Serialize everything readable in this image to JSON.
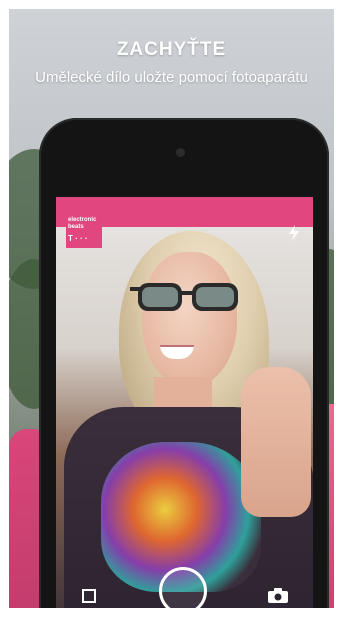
{
  "header": {
    "title": "ZACHYŤTE",
    "subtitle": "Umělecké dílo uložte pomocí fotoaparátu"
  },
  "app": {
    "brand_label": "electronic beats",
    "brand_mark": "T · · ·"
  },
  "colors": {
    "accent": "#e2467f",
    "phone": "#141414"
  },
  "icons": {
    "flash": "flash-icon",
    "gallery": "gallery-icon",
    "shutter": "shutter-button",
    "switch_camera": "switch-camera-icon"
  }
}
